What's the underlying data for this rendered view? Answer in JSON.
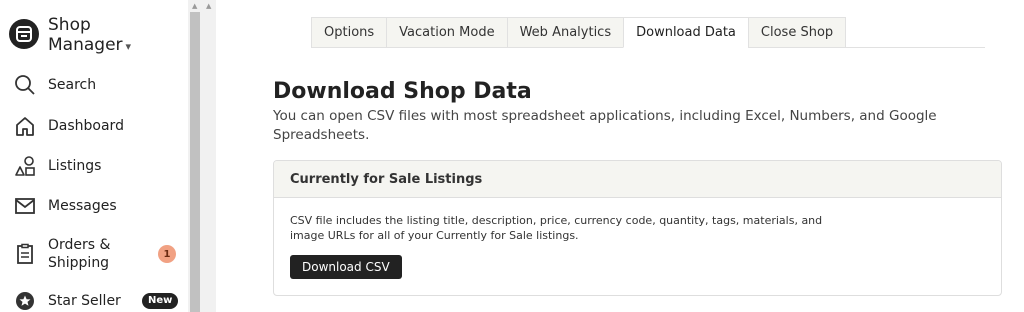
{
  "brand": {
    "line1": "Shop",
    "line2": "Manager",
    "caret": "▾",
    "logo_icon": "shop-icon"
  },
  "nav": [
    {
      "label": "Search",
      "icon": "search-icon"
    },
    {
      "label": "Dashboard",
      "icon": "home-icon"
    },
    {
      "label": "Listings",
      "icon": "shapes-icon"
    },
    {
      "label": "Messages",
      "icon": "envelope-icon"
    },
    {
      "label": "Orders &",
      "label2": "Shipping",
      "icon": "clipboard-icon",
      "badge": "1"
    },
    {
      "label": "Star Seller",
      "icon": "star-icon",
      "badge": "New"
    }
  ],
  "scrollbar": {
    "up": "▲",
    "down": "▲"
  },
  "tabs": [
    {
      "label": "Options"
    },
    {
      "label": "Vacation Mode"
    },
    {
      "label": "Web Analytics"
    },
    {
      "label": "Download Data",
      "active": true
    },
    {
      "label": "Close Shop"
    }
  ],
  "main": {
    "title": "Download Shop Data",
    "description": "You can open CSV files with most spreadsheet applications, including Excel, Numbers, and Google Spreadsheets."
  },
  "card": {
    "header": "Currently for Sale Listings",
    "text": "CSV file includes the listing title, description, price, currency code, quantity, tags, materials, and image URLs for all of your Currently for Sale listings.",
    "button": "Download CSV"
  },
  "colors": {
    "badge_bg": "#f1a183",
    "dark": "#222222",
    "header_bg": "#f5f5f1"
  }
}
